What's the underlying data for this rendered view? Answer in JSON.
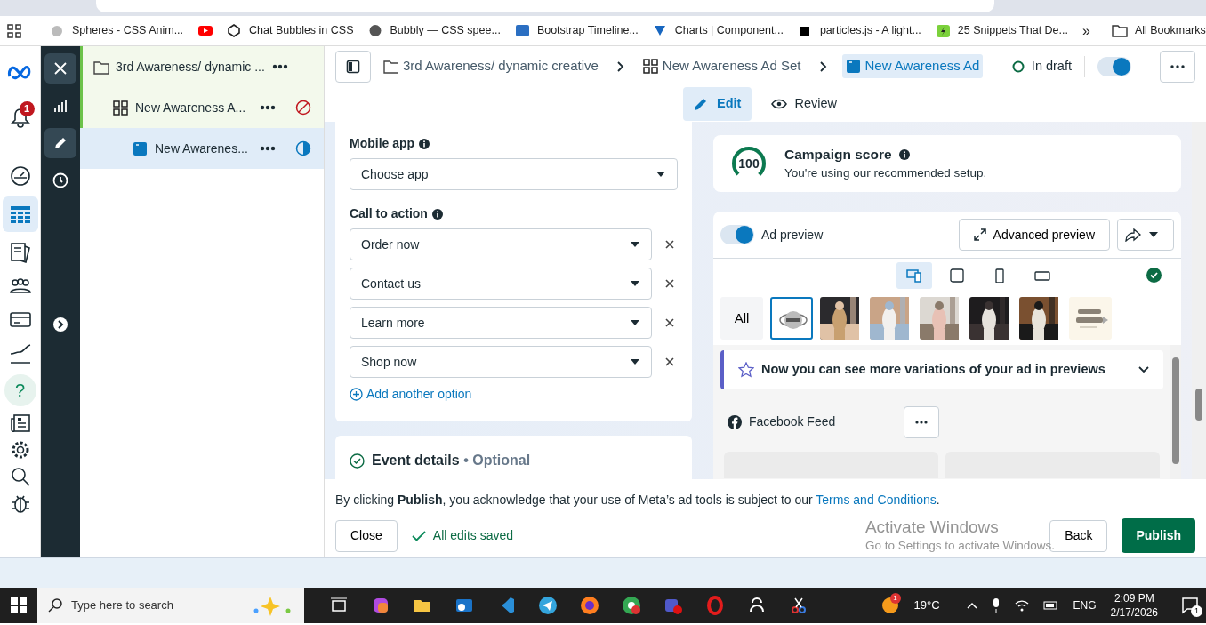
{
  "bookmarks": [
    {
      "label": "Spheres - CSS Anim...",
      "kind": "cloud"
    },
    {
      "kind": "youtube"
    },
    {
      "label": "Chat Bubbles in CSS",
      "kind": "codepen"
    },
    {
      "label": "Bubbly — CSS spee...",
      "kind": "globe"
    },
    {
      "label": "Bootstrap Timeline...",
      "kind": "bootstrap"
    },
    {
      "label": "Charts | Component...",
      "kind": "vuetify"
    },
    {
      "label": "particles.js - A light...",
      "kind": "square"
    },
    {
      "label": "25 Snippets That De...",
      "kind": "bolt"
    }
  ],
  "bookmarks_more": "»",
  "all_bookmarks": "All Bookmarks",
  "nav": {
    "notifications": "1",
    "help": "?",
    "items": [
      {
        "kind": "gauge",
        "selected": false
      },
      {
        "kind": "table",
        "selected": true
      },
      {
        "kind": "pages",
        "selected": false
      },
      {
        "kind": "people",
        "selected": false
      },
      {
        "kind": "card",
        "selected": false
      },
      {
        "kind": "line",
        "selected": false
      }
    ]
  },
  "tree": [
    {
      "label": "3rd Awareness/ dynamic ...",
      "kind": "campaign",
      "selected": false,
      "children": [
        {
          "label": "New Awareness A...",
          "kind": "adset",
          "selected": false,
          "delivering": false,
          "children": [
            {
              "label": "New Awarenes...",
              "kind": "ad",
              "selected": true,
              "draft": true
            }
          ]
        }
      ]
    }
  ],
  "breadcrumbs": [
    {
      "label": "3rd Awareness/ dynamic creative",
      "kind": "campaign",
      "selected": false
    },
    {
      "label": "New Awareness Ad Set",
      "kind": "adset",
      "selected": false
    },
    {
      "label": "New Awareness Ad",
      "kind": "ad",
      "selected": true
    }
  ],
  "draft_status": "In draft",
  "ad_on": true,
  "tabs": [
    {
      "label": "Edit",
      "kind": "edit",
      "selected": true
    },
    {
      "label": "Review",
      "kind": "review",
      "selected": false
    }
  ],
  "mobile_app": {
    "label": "Mobile app",
    "value": "Choose app"
  },
  "call_to_action": {
    "label": "Call to action",
    "options": [
      "Order now",
      "Contact us",
      "Learn more",
      "Shop now"
    ],
    "add": "Add another option"
  },
  "event_details": {
    "title": "Event details",
    "optional": "• Optional"
  },
  "score": {
    "value": "100",
    "title": "Campaign score",
    "subtitle": "You're using our recommended setup."
  },
  "preview": {
    "label": "Ad preview",
    "on": true,
    "advanced": "Advanced preview",
    "formats": [
      {
        "kind": "devices",
        "selected": true
      },
      {
        "kind": "square",
        "selected": false
      },
      {
        "kind": "vertical",
        "selected": false
      },
      {
        "kind": "horizontal",
        "selected": false
      }
    ],
    "filter": "All",
    "thumbs": [
      {
        "kind": "logo",
        "selected": true
      },
      {
        "kind": "picture",
        "selected": false
      },
      {
        "kind": "picture",
        "selected": false
      },
      {
        "kind": "picture",
        "selected": false
      },
      {
        "kind": "picture",
        "selected": false
      },
      {
        "kind": "picture",
        "selected": false
      },
      {
        "kind": "cream",
        "selected": false
      }
    ],
    "banner": "Now you can see more variations of your ad in previews",
    "placement": "Facebook Feed"
  },
  "footer": {
    "notice": "By clicking **Publish**, you acknowledge that your use of Meta’s ad tools is subject to our",
    "link": "Terms and Conditions",
    "end": ".",
    "close": "Close",
    "saved": "All edits saved",
    "back": "Back",
    "publish": "Publish"
  },
  "activation": {
    "title": "Activate Windows",
    "hint": "Go to Settings to activate Windows."
  },
  "taskbar": {
    "search": "Type here to search",
    "weather_badge": "1",
    "temperature": "19°C",
    "language": "ENG",
    "time": "2:09 PM",
    "date": "2/17/2026",
    "notifications": "1"
  }
}
